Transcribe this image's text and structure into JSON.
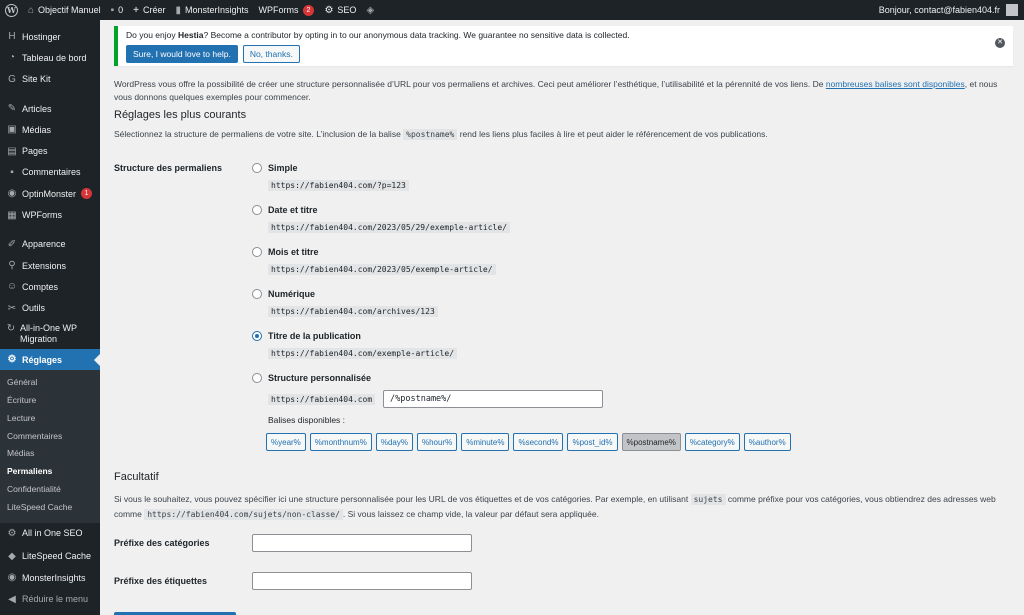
{
  "adminbar": {
    "site_name": "Objectif Manuel",
    "comments_count": "0",
    "new_label": "Créer",
    "monsterinsights": "MonsterInsights",
    "wpforms": "WPForms",
    "wpforms_badge": "2",
    "seo": "SEO",
    "greeting": "Bonjour, contact@fabien404.fr"
  },
  "sidebar": {
    "items": [
      {
        "label": "Hostinger",
        "icon": "hostinger-icon"
      },
      {
        "label": "Tableau de bord",
        "icon": "dashboard-icon"
      },
      {
        "label": "Site Kit",
        "icon": "sitekit-icon"
      },
      {
        "label": "Articles",
        "icon": "pin-icon"
      },
      {
        "label": "Médias",
        "icon": "media-icon"
      },
      {
        "label": "Pages",
        "icon": "page-icon"
      },
      {
        "label": "Commentaires",
        "icon": "comment-icon"
      },
      {
        "label": "OptinMonster",
        "icon": "optinmonster-icon",
        "badge": "1"
      },
      {
        "label": "WPForms",
        "icon": "wpforms-icon"
      },
      {
        "label": "Apparence",
        "icon": "appearance-icon"
      },
      {
        "label": "Extensions",
        "icon": "plugin-icon"
      },
      {
        "label": "Comptes",
        "icon": "users-icon"
      },
      {
        "label": "Outils",
        "icon": "tools-icon"
      },
      {
        "label": "All-in-One WP Migration",
        "icon": "migration-icon"
      },
      {
        "label": "Réglages",
        "icon": "settings-icon"
      }
    ],
    "submenu": [
      "Général",
      "Écriture",
      "Lecture",
      "Commentaires",
      "Médias",
      "Permaliens",
      "Confidentialité",
      "LiteSpeed Cache"
    ],
    "after": [
      {
        "label": "All in One SEO",
        "icon": "aioseo-icon"
      },
      {
        "label": "LiteSpeed Cache",
        "icon": "litespeed-icon"
      },
      {
        "label": "MonsterInsights",
        "icon": "monsterinsights-icon"
      }
    ],
    "collapse": "Réduire le menu"
  },
  "notice": {
    "text_before": "Do you enjoy ",
    "text_bold": "Hestia",
    "text_after": "? Become a contributor by opting in to our anonymous data tracking. We guarantee no sensitive data is collected.",
    "yes": "Sure, I would love to help.",
    "no": "No, thanks."
  },
  "intro": {
    "text_before": "WordPress vous offre la possibilité de créer une structure personnalisée d’URL pour vos permaliens et archives. Ceci peut améliorer l’esthétique, l’utilisabilité et la pérennité de vos liens. De ",
    "link": "nombreuses balises sont disponibles",
    "text_after": ", et nous vous donnons quelques exemples pour commencer."
  },
  "common": {
    "title": "Réglages les plus courants",
    "desc_before": "Sélectionnez la structure de permaliens de votre site. L’inclusion de la balise ",
    "desc_code": "%postname%",
    "desc_after": " rend les liens plus faciles à lire et peut aider le référencement de vos publications.",
    "field_label": "Structure des permaliens",
    "options": [
      {
        "label": "Simple",
        "example": "https://fabien404.com/?p=123",
        "checked": false
      },
      {
        "label": "Date et titre",
        "example": "https://fabien404.com/2023/05/29/exemple-article/",
        "checked": false
      },
      {
        "label": "Mois et titre",
        "example": "https://fabien404.com/2023/05/exemple-article/",
        "checked": false
      },
      {
        "label": "Numérique",
        "example": "https://fabien404.com/archives/123",
        "checked": false
      },
      {
        "label": "Titre de la publication",
        "example": "https://fabien404.com/exemple-article/",
        "checked": true
      },
      {
        "label": "Structure personnalisée",
        "example": "https://fabien404.com",
        "checked": false
      }
    ],
    "custom_value": "/%postname%/",
    "tags_label": "Balises disponibles :",
    "tags": [
      "%year%",
      "%monthnum%",
      "%day%",
      "%hour%",
      "%minute%",
      "%second%",
      "%post_id%",
      "%postname%",
      "%category%",
      "%author%"
    ],
    "pressed_tag": "%postname%"
  },
  "optional": {
    "title": "Facultatif",
    "desc_1": "Si vous le souhaitez, vous pouvez spécifier ici une structure personnalisée pour les URL de vos étiquettes et de vos catégories. Par exemple, en utilisant ",
    "desc_code1": "sujets",
    "desc_2": " comme préfixe pour vos catégories, vous obtiendrez des adresses web",
    "desc_3": "comme ",
    "desc_code2": "https://fabien404.com/sujets/non-classe/",
    "desc_4": ". Si vous laissez ce champ vide, la valeur par défaut sera appliquée.",
    "category_label": "Préfixe des catégories",
    "tag_label": "Préfixe des étiquettes"
  },
  "colors": {
    "accent": "#2271b1",
    "sidebar": "#1d2327",
    "notice": "#00a32a",
    "badge": "#d63638"
  }
}
